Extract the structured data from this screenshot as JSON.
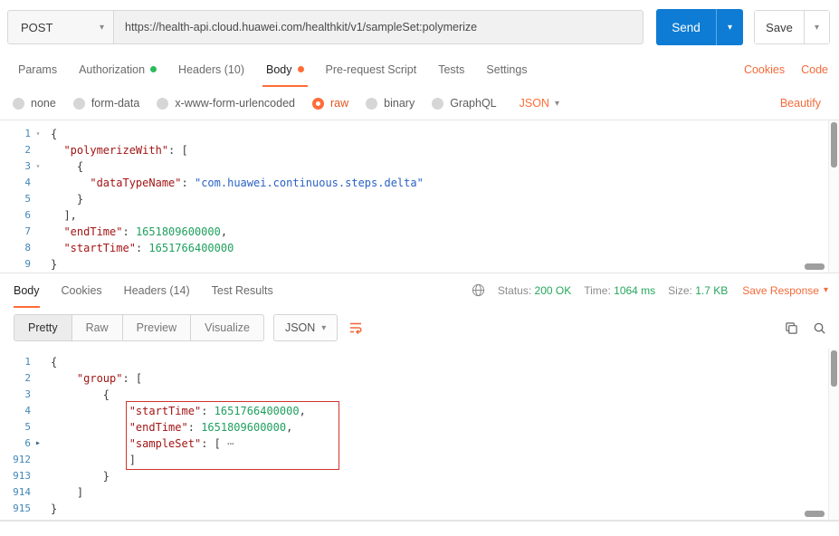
{
  "colors": {
    "accent_orange": "#ff6c37",
    "link_orange": "#f26b3a",
    "send_button_blue": "#0e7cd4",
    "status_green": "#26a65b",
    "annotation_red": "#d0342c",
    "line_number_blue": "#4287b9",
    "token_key_red": "#a31515",
    "token_string_blue": "#2962c4",
    "token_number_green": "#1fa05e"
  },
  "icons": {
    "caret_down": "▾",
    "fold_open": "▾",
    "fold_collapsed": "▸",
    "ellipsis": "⋯"
  },
  "request_bar": {
    "method": "POST",
    "url": "https://health-api.cloud.huawei.com/healthkit/v1/sampleSet:polymerize",
    "send_label": "Send",
    "save_label": "Save"
  },
  "request_tabs": {
    "active": "Body",
    "items": [
      {
        "label": "Params"
      },
      {
        "label": "Authorization",
        "dot": "green"
      },
      {
        "label": "Headers (10)"
      },
      {
        "label": "Body",
        "dot": "orange"
      },
      {
        "label": "Pre-request Script"
      },
      {
        "label": "Tests"
      },
      {
        "label": "Settings"
      }
    ],
    "cookies_label": "Cookies",
    "code_label": "Code"
  },
  "body_type_bar": {
    "options": [
      "none",
      "form-data",
      "x-www-form-urlencoded",
      "raw",
      "binary",
      "GraphQL"
    ],
    "selected": "raw",
    "format_label": "JSON",
    "beautify_label": "Beautify"
  },
  "request_editor": {
    "lines": [
      {
        "num": "1",
        "fold": "open",
        "tokens": [
          [
            "p",
            "{"
          ]
        ]
      },
      {
        "num": "2",
        "tokens": [
          [
            "p",
            "  "
          ],
          [
            "k",
            "\"polymerizeWith\""
          ],
          [
            "p",
            ": ["
          ]
        ]
      },
      {
        "num": "3",
        "fold": "open",
        "tokens": [
          [
            "p",
            "    {"
          ]
        ]
      },
      {
        "num": "4",
        "tokens": [
          [
            "p",
            "      "
          ],
          [
            "k",
            "\"dataTypeName\""
          ],
          [
            "p",
            ": "
          ],
          [
            "s",
            "\"com.huawei.continuous.steps.delta\""
          ]
        ]
      },
      {
        "num": "5",
        "tokens": [
          [
            "p",
            "    }"
          ]
        ]
      },
      {
        "num": "6",
        "tokens": [
          [
            "p",
            "  ],"
          ]
        ]
      },
      {
        "num": "7",
        "tokens": [
          [
            "p",
            "  "
          ],
          [
            "k",
            "\"endTime\""
          ],
          [
            "p",
            ": "
          ],
          [
            "n",
            "1651809600000"
          ],
          [
            "p",
            ","
          ]
        ]
      },
      {
        "num": "8",
        "tokens": [
          [
            "p",
            "  "
          ],
          [
            "k",
            "\"startTime\""
          ],
          [
            "p",
            ": "
          ],
          [
            "n",
            "1651766400000"
          ]
        ]
      },
      {
        "num": "9",
        "tokens": [
          [
            "p",
            "}"
          ]
        ]
      }
    ]
  },
  "response_header": {
    "active": "Body",
    "tabs": [
      "Body",
      "Cookies",
      "Headers (14)",
      "Test Results"
    ],
    "status_label": "Status:",
    "status_value": "200 OK",
    "time_label": "Time:",
    "time_value": "1064 ms",
    "size_label": "Size:",
    "size_value": "1.7 KB",
    "save_response_label": "Save Response"
  },
  "response_toolbar": {
    "active": "Pretty",
    "views": [
      "Pretty",
      "Raw",
      "Preview",
      "Visualize"
    ],
    "format_label": "JSON"
  },
  "response_editor": {
    "highlight_box_lines": [
      "4",
      "5",
      "6",
      "912"
    ],
    "lines": [
      {
        "num": "1",
        "tokens": [
          [
            "p",
            "{"
          ]
        ]
      },
      {
        "num": "2",
        "tokens": [
          [
            "p",
            "    "
          ],
          [
            "k",
            "\"group\""
          ],
          [
            "p",
            ": ["
          ]
        ]
      },
      {
        "num": "3",
        "tokens": [
          [
            "p",
            "        {"
          ]
        ]
      },
      {
        "num": "4",
        "tokens": [
          [
            "p",
            "            "
          ],
          [
            "k",
            "\"startTime\""
          ],
          [
            "p",
            ": "
          ],
          [
            "n",
            "1651766400000"
          ],
          [
            "p",
            ","
          ]
        ]
      },
      {
        "num": "5",
        "tokens": [
          [
            "p",
            "            "
          ],
          [
            "k",
            "\"endTime\""
          ],
          [
            "p",
            ": "
          ],
          [
            "n",
            "1651809600000"
          ],
          [
            "p",
            ","
          ]
        ]
      },
      {
        "num": "6",
        "fold": "collapsed",
        "tokens": [
          [
            "p",
            "            "
          ],
          [
            "k",
            "\"sampleSet\""
          ],
          [
            "p",
            ": [ "
          ]
        ],
        "ellipsis": true
      },
      {
        "num": "912",
        "tokens": [
          [
            "p",
            "            ]"
          ]
        ]
      },
      {
        "num": "913",
        "tokens": [
          [
            "p",
            "        }"
          ]
        ]
      },
      {
        "num": "914",
        "tokens": [
          [
            "p",
            "    ]"
          ]
        ]
      },
      {
        "num": "915",
        "tokens": [
          [
            "p",
            "}"
          ]
        ]
      }
    ]
  }
}
